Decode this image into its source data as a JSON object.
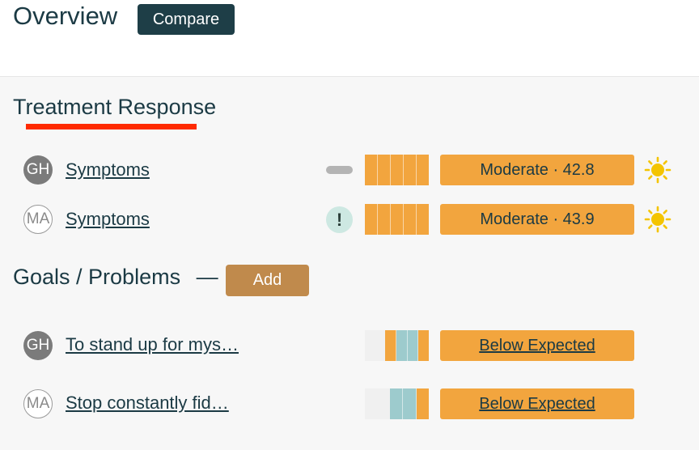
{
  "header": {
    "title": "Overview",
    "compare_label": "Compare"
  },
  "treatment": {
    "title": "Treatment Response",
    "rows": [
      {
        "avatar": "GH",
        "label": "Symptoms",
        "indicator": "dash",
        "result": "Moderate · 42.8",
        "icon": "sun-icon"
      },
      {
        "avatar": "MA",
        "label": "Symptoms",
        "indicator": "!",
        "result": "Moderate · 43.9",
        "icon": "sun-icon"
      }
    ]
  },
  "goals": {
    "title": "Goals / Problems",
    "separator": "—",
    "add_label": "Add",
    "rows": [
      {
        "avatar": "GH",
        "label": "To stand up for mys…",
        "result": "Below Expected"
      },
      {
        "avatar": "MA",
        "label": "Stop constantly fid…",
        "result": "Below Expected"
      }
    ]
  },
  "colors": {
    "accent": "#f2a53e",
    "teal": "#9dcbcd",
    "light": "#f0f0f0",
    "dark": "#1e3e47",
    "brown": "#c08a4c",
    "underline": "#ff2a00"
  }
}
